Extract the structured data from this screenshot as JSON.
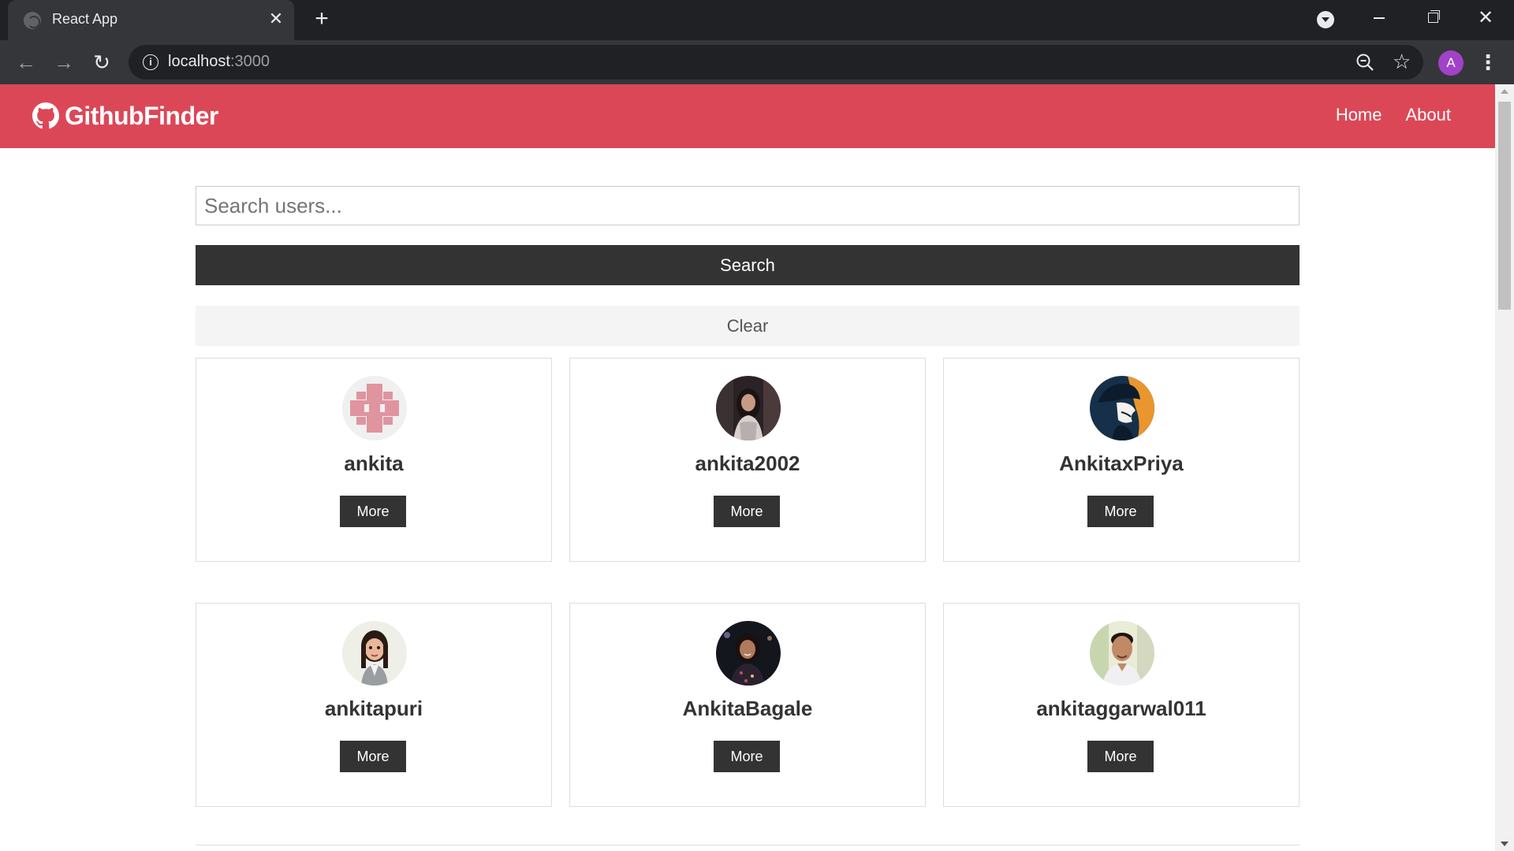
{
  "browser": {
    "tab_title": "React App",
    "url_host": "localhost",
    "url_port": ":3000",
    "profile_initial": "A"
  },
  "navbar": {
    "brand": "GithubFinder",
    "links": [
      "Home",
      "About"
    ],
    "color": "#dc4757"
  },
  "search": {
    "placeholder": "Search users...",
    "submit_label": "Search",
    "clear_label": "Clear"
  },
  "users": [
    {
      "login": "ankita",
      "more_label": "More",
      "avatar_icon": "identicon-pink-puzzle"
    },
    {
      "login": "ankita2002",
      "more_label": "More",
      "avatar_icon": "photo-woman"
    },
    {
      "login": "AnkitaxPriya",
      "more_label": "More",
      "avatar_icon": "illustration-dark-orange"
    },
    {
      "login": "ankitapuri",
      "more_label": "More",
      "avatar_icon": "cartoon-woman"
    },
    {
      "login": "AnkitaBagale",
      "more_label": "More",
      "avatar_icon": "photo-woman-dark"
    },
    {
      "login": "ankitaggarwal011",
      "more_label": "More",
      "avatar_icon": "photo-man"
    }
  ]
}
